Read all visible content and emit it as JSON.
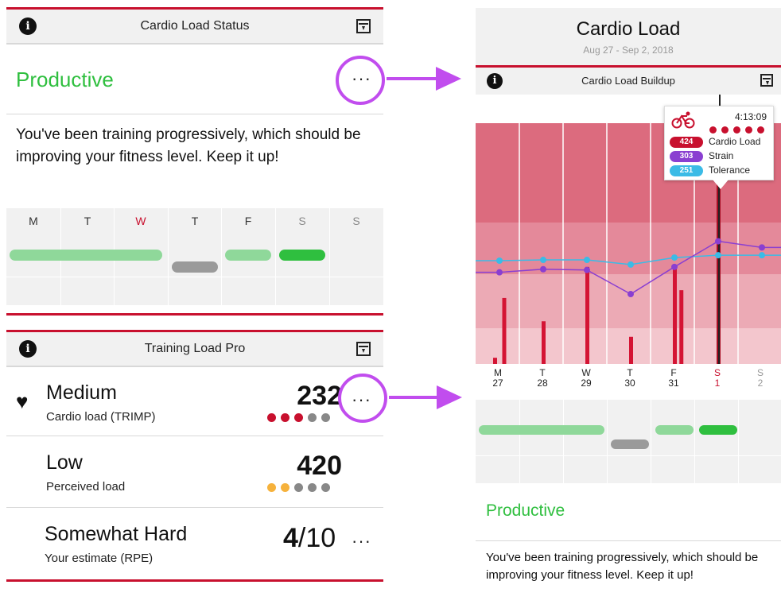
{
  "left": {
    "cardio_panel": {
      "title": "Cardio Load Status",
      "info_icon": "info-icon",
      "save_icon": "save-icon",
      "status": "Productive",
      "more_label": "···",
      "description": "You've been training progressively, which should be improving your fitness level. Keep it up!",
      "days": [
        "M",
        "T",
        "W",
        "T",
        "F",
        "S",
        "S"
      ]
    },
    "training_panel": {
      "title": "Training Load Pro",
      "rows": [
        {
          "title": "Medium",
          "subtitle": "Cardio load (TRIMP)",
          "value": "232",
          "more_label": "···",
          "icon": "heart-icon",
          "dots_filled": 3,
          "dots_total": 5
        },
        {
          "title": "Low",
          "subtitle": "Perceived load",
          "value": "420",
          "dots_filled": 2,
          "dots_total": 5
        },
        {
          "title": "Somewhat Hard",
          "subtitle": "Your estimate (RPE)",
          "value_bold": "4",
          "value_rest": "/10",
          "more_label": "···"
        }
      ]
    }
  },
  "right": {
    "title": "Cardio Load",
    "date_range": "Aug 27 - Sep 2, 2018",
    "panel_title": "Cardio Load Buildup",
    "tooltip": {
      "time": "4:13:09",
      "icon": "bike-icon",
      "intensity_dots": 5,
      "items": [
        {
          "value": "424",
          "label": "Cardio Load",
          "color": "#c8102e"
        },
        {
          "value": "303",
          "label": "Strain",
          "color": "#8a3fd1"
        },
        {
          "value": "251",
          "label": "Tolerance",
          "color": "#3bbbe6"
        }
      ]
    },
    "axis": [
      {
        "day": "M",
        "date": "27"
      },
      {
        "day": "T",
        "date": "28"
      },
      {
        "day": "W",
        "date": "29"
      },
      {
        "day": "T",
        "date": "30"
      },
      {
        "day": "F",
        "date": "31"
      },
      {
        "day": "S",
        "date": "1"
      },
      {
        "day": "S",
        "date": "2"
      }
    ],
    "status": "Productive",
    "description": "You've been training progressively, which should be improving your fitness level. Keep it up!"
  },
  "colors": {
    "accent_red": "#c8102e",
    "productive_green": "#2fbf3f",
    "highlight_purple": "#c14dee",
    "pill_light_green": "#8fd89a",
    "pill_green": "#2fbf3f",
    "pill_gray": "#9a9a9a"
  },
  "chart_data": {
    "type": "bar",
    "categories": [
      "M 27",
      "T 28",
      "W 29",
      "T 30",
      "F 31",
      "S 1",
      "S 2"
    ],
    "series": [
      {
        "name": "Cardio Load",
        "bars": [
          [
            0,
            8
          ],
          [
            0.1,
            85
          ],
          [
            1,
            55
          ],
          [
            2,
            125
          ],
          [
            3,
            35
          ],
          [
            4,
            123
          ],
          [
            4.15,
            95
          ],
          [
            5,
            303
          ]
        ]
      },
      {
        "name": "Strain",
        "values": [
          118,
          122,
          121,
          90,
          125,
          158,
          150
        ]
      },
      {
        "name": "Tolerance",
        "values": [
          133,
          134,
          134,
          128,
          137,
          140,
          140
        ]
      }
    ],
    "ylim": [
      0,
      310
    ]
  }
}
